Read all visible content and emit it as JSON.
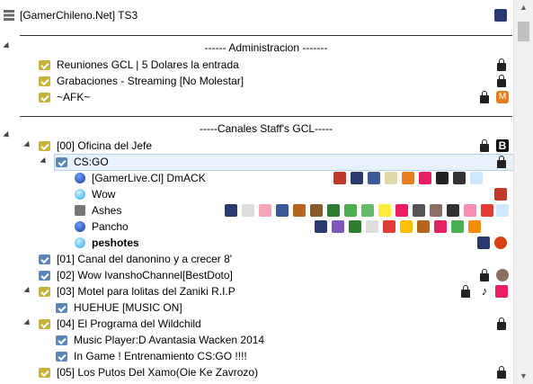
{
  "server": {
    "name": "[GamerChileno.Net] TS3"
  },
  "spacers": {
    "admin": "------ Administracion -------",
    "staff": "-----Canales Staff's GCL-----"
  },
  "channels": {
    "reuniones": "Reuniones GCL | 5 Dolares la entrada",
    "grabaciones": "Grabaciones - Streaming [No Molestar]",
    "afk": "~AFK~",
    "oficina": "[00] Oficina del Jefe",
    "csgo": "CS:GO",
    "danonino": "[01] Canal del danonino y a crecer 8'",
    "wow": "[02] Wow IvanshoChannel[BestDoto]",
    "motel": "[03] Motel para lolitas del Zaniki R.I.P",
    "huehue": "HUEHUE [MUSIC ON]",
    "programa": "[04] El Programa del Wildchild",
    "musicplayer": "Music Player:D Avantasia Wacken 2014",
    "ingame": "In Game ! Entrenamiento CS:GO !!!!",
    "putos": "[05] Los Putos Del Xamo(Oie Ke Zavrozo)"
  },
  "clients": {
    "dmack": "[GamerLive.Cl] DmACK",
    "wow": "Wow",
    "ashes": "Ashes",
    "pancho": "Pancho",
    "peshotes": "peshotes"
  },
  "colors": {
    "accent": "#5a86b8",
    "channel": "#c9b23a"
  }
}
